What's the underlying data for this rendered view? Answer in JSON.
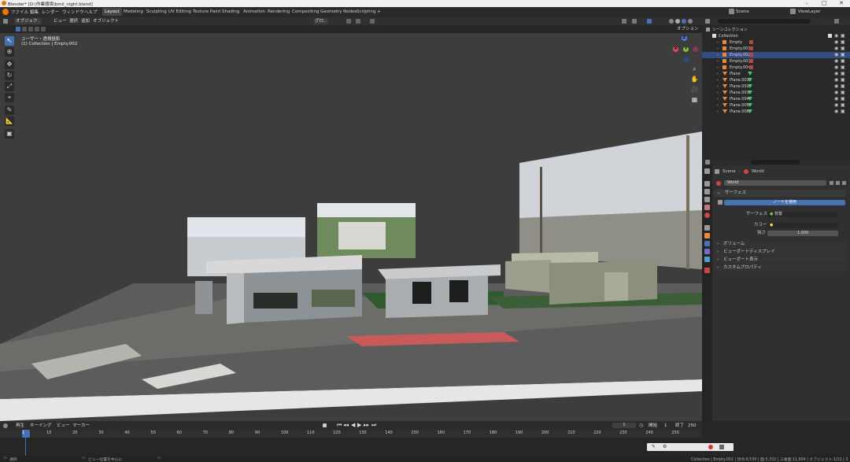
{
  "window": {
    "title": "Blender* [D:\\作業環境\\bmii_night.blend]"
  },
  "menus": [
    "ファイル",
    "編集",
    "レンダー",
    "ウィンドウ",
    "ヘルプ"
  ],
  "workspaces": [
    "Layout",
    "Modeling",
    "Sculpting",
    "UV Editing",
    "Texture Paint",
    "Shading",
    "Animation",
    "Rendering",
    "Compositing",
    "Geometry Nodes",
    "Scripting",
    "+"
  ],
  "top_right": {
    "scene": "Scene",
    "view_layer": "ViewLayer"
  },
  "viewport_header": {
    "mode": "オブジェク..",
    "items": [
      "ビュー",
      "選択",
      "追加",
      "オブジェクト"
    ],
    "transform": "グロ..",
    "options": "オプション"
  },
  "viewport_overlay": {
    "line1": "ユーザー・透視投影",
    "line2": "(1) Collection | Empty.002"
  },
  "axes": {
    "x": "X",
    "y": "Y",
    "z": "Z"
  },
  "outliner": {
    "root": "シーンコレクション",
    "collection": "Collection",
    "items": [
      {
        "name": "Empty",
        "kind": "empty"
      },
      {
        "name": "Empty.001",
        "kind": "empty"
      },
      {
        "name": "Empty.002",
        "kind": "empty",
        "selected": true
      },
      {
        "name": "Empty.003",
        "kind": "empty"
      },
      {
        "name": "Empty.004",
        "kind": "empty"
      },
      {
        "name": "Plane",
        "kind": "mesh"
      },
      {
        "name": "Plane.001",
        "kind": "mesh"
      },
      {
        "name": "Plane.002",
        "kind": "mesh"
      },
      {
        "name": "Plane.003",
        "kind": "mesh"
      },
      {
        "name": "Plane.004",
        "kind": "mesh"
      },
      {
        "name": "Plane.005",
        "kind": "mesh"
      },
      {
        "name": "Plane.006",
        "kind": "mesh"
      }
    ]
  },
  "properties": {
    "breadcrumb_scene": "Scene",
    "breadcrumb_world": "World",
    "world_name": "World",
    "surface_panel": "サーフェス",
    "use_nodes": "ノードを使用",
    "surface_label": "サーフェス",
    "surface_value": "背景",
    "color_label": "カラー",
    "strength_label": "強さ",
    "strength_value": "1.000",
    "panels": [
      "ボリューム",
      "ビューポートディスプレイ",
      "ビューポート表示",
      "カスタムプロパティ"
    ]
  },
  "timeline": {
    "menus": [
      "再生",
      "キーイング",
      "ビュー",
      "マーカー"
    ],
    "current_frame": "1",
    "start_label": "開始",
    "start": "1",
    "end_label": "終了",
    "end": "250",
    "ticks": [
      "1",
      "10",
      "20",
      "30",
      "40",
      "50",
      "60",
      "70",
      "80",
      "90",
      "100",
      "110",
      "120",
      "130",
      "140",
      "150",
      "160",
      "170",
      "180",
      "190",
      "200",
      "210",
      "220",
      "230",
      "240",
      "250"
    ]
  },
  "status": {
    "left": "選択",
    "middle": "ビュー位置を中心に",
    "right": "Collection | Empty.002 | 頂点:6,530 | 面:5,332 | 三角面:11,604 | オブジェクト:1/12 | 3.6.23"
  },
  "colors": {
    "accent": "#4772b3",
    "selected_row": "#334d80",
    "empty_icon": "#e88a3c",
    "mesh_icon": "#e88a3c",
    "modifier_green": "#4ac27a"
  }
}
